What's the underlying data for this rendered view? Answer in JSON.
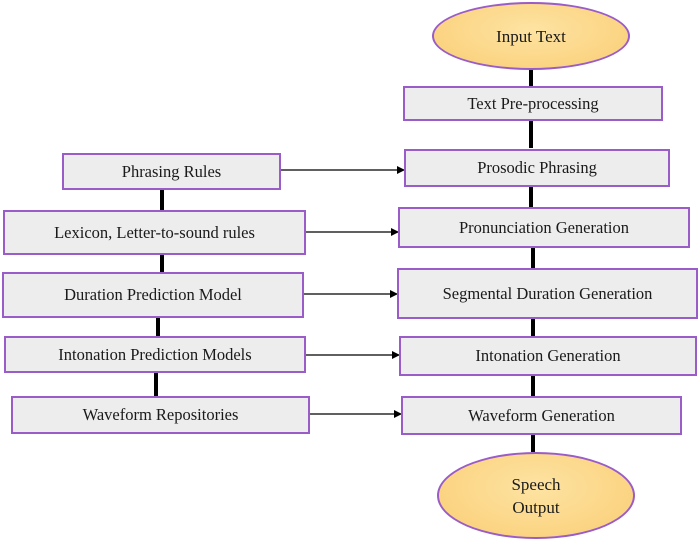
{
  "colors": {
    "box_fill": "#ededed",
    "border": "#9a5cc8",
    "terminal_fill": "#fbd27e",
    "arrow": "#000000"
  },
  "start": "Input Text",
  "end": {
    "line1": "Speech",
    "line2": "Output"
  },
  "pipeline": [
    "Text Pre-processing",
    "Prosodic Phrasing",
    "Pronunciation Generation",
    "Segmental Duration Generation",
    "Intonation Generation",
    "Waveform Generation"
  ],
  "resources": [
    "Phrasing Rules",
    "Lexicon, Letter-to-sound rules",
    "Duration Prediction Model",
    "Intonation Prediction Models",
    "Waveform Repositories"
  ]
}
